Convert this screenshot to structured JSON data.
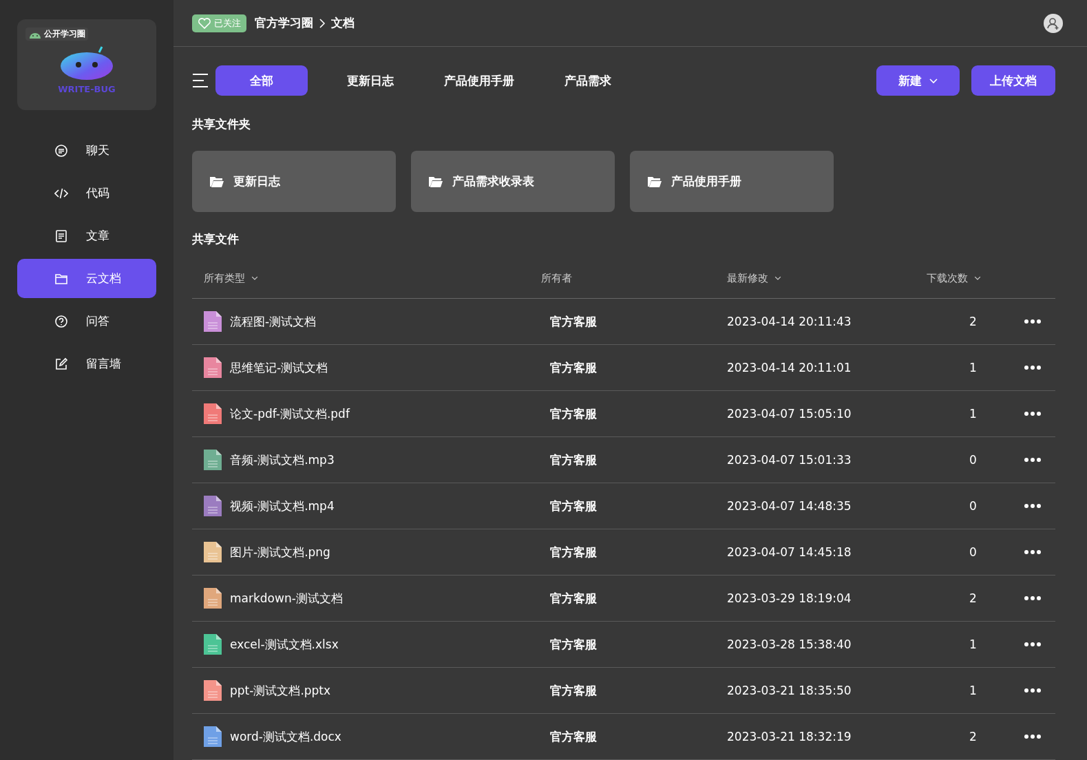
{
  "logo": {
    "badge": "公开学习圈",
    "wordmark": "WRITE-BUG"
  },
  "sidebar": {
    "items": [
      {
        "label": "聊天",
        "kind": "chat",
        "selected": false
      },
      {
        "label": "代码",
        "kind": "code",
        "selected": false
      },
      {
        "label": "文章",
        "kind": "article",
        "selected": false
      },
      {
        "label": "云文档",
        "kind": "folder",
        "selected": true
      },
      {
        "label": "问答",
        "kind": "help",
        "selected": false
      },
      {
        "label": "留言墙",
        "kind": "edit",
        "selected": false
      }
    ]
  },
  "header": {
    "follow_badge": "已关注",
    "breadcrumb": [
      "官方学习圈",
      "文档"
    ]
  },
  "tabs": [
    {
      "label": "全部",
      "selected": true
    },
    {
      "label": "更新日志",
      "selected": false
    },
    {
      "label": "产品使用手册",
      "selected": false
    },
    {
      "label": "产品需求",
      "selected": false
    }
  ],
  "actions": {
    "new": "新建",
    "upload": "上传文档"
  },
  "folders": {
    "title": "共享文件夹",
    "items": [
      "更新日志",
      "产品需求收录表",
      "产品使用手册"
    ]
  },
  "files": {
    "title": "共享文件",
    "columns": [
      {
        "label": "所有类型",
        "sortable": true
      },
      {
        "label": "所有者",
        "sortable": false
      },
      {
        "label": "最新修改",
        "sortable": true
      },
      {
        "label": "下载次数",
        "sortable": true
      }
    ],
    "rows": [
      {
        "name": "流程图-测试文档",
        "owner": "官方客服",
        "modified": "2023-04-14 20:11:43",
        "downloads": "2",
        "color": "#c98fd8"
      },
      {
        "name": "思维笔记-测试文档",
        "owner": "官方客服",
        "modified": "2023-04-14 20:11:01",
        "downloads": "1",
        "color": "#e8869f"
      },
      {
        "name": "论文-pdf-测试文档.pdf",
        "owner": "官方客服",
        "modified": "2023-04-07 15:05:10",
        "downloads": "1",
        "color": "#f07a78"
      },
      {
        "name": "音频-测试文档.mp3",
        "owner": "官方客服",
        "modified": "2023-04-07 15:01:33",
        "downloads": "0",
        "color": "#6fae92"
      },
      {
        "name": "视频-测试文档.mp4",
        "owner": "官方客服",
        "modified": "2023-04-07 14:48:35",
        "downloads": "0",
        "color": "#9b7cc0"
      },
      {
        "name": "图片-测试文档.png",
        "owner": "官方客服",
        "modified": "2023-04-07 14:45:18",
        "downloads": "0",
        "color": "#e9c393"
      },
      {
        "name": "markdown-测试文档",
        "owner": "官方客服",
        "modified": "2023-03-29 18:19:04",
        "downloads": "2",
        "color": "#e0a77c"
      },
      {
        "name": "excel-测试文档.xlsx",
        "owner": "官方客服",
        "modified": "2023-03-28 15:38:40",
        "downloads": "1",
        "color": "#4cc495"
      },
      {
        "name": "ppt-测试文档.pptx",
        "owner": "官方客服",
        "modified": "2023-03-21 18:35:50",
        "downloads": "1",
        "color": "#f4948a"
      },
      {
        "name": "word-测试文档.docx",
        "owner": "官方客服",
        "modified": "2023-03-21 18:32:19",
        "downloads": "2",
        "color": "#6fa0e6"
      }
    ]
  }
}
